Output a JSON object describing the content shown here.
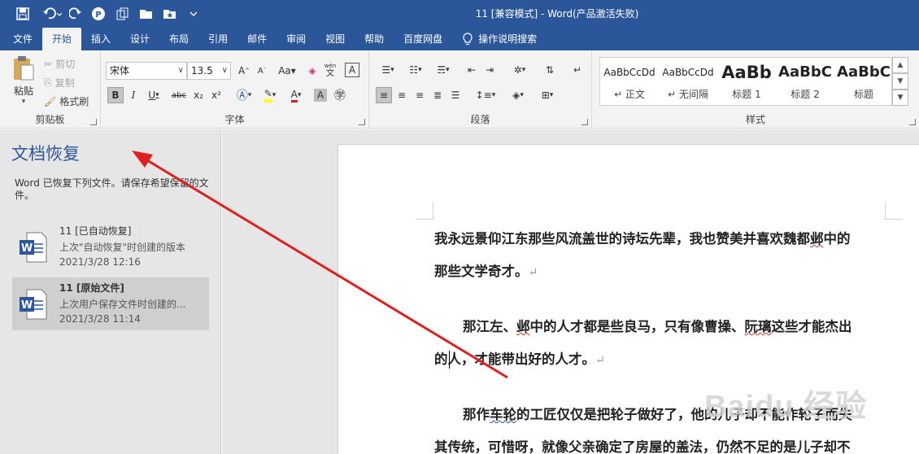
{
  "window": {
    "title": "11  [兼容模式]  -  Word(产品激活失败)"
  },
  "quick_access": [
    "save-icon",
    "undo-icon",
    "redo-icon",
    "p-icon",
    "copy-layout-icon",
    "open-folder-icon",
    "star-folder-icon",
    "customize-icon"
  ],
  "tabs": [
    "文件",
    "开始",
    "插入",
    "设计",
    "布局",
    "引用",
    "邮件",
    "审阅",
    "视图",
    "帮助",
    "百度网盘",
    "操作说明搜索"
  ],
  "active_tab": "开始",
  "ribbon": {
    "clipboard": {
      "paste": "粘贴",
      "cut": "剪切",
      "copy": "复制",
      "format_painter": "格式刷",
      "label": "剪贴板"
    },
    "font": {
      "font_name": "宋体",
      "font_size": "13.5",
      "label": "字体",
      "aa": "Aa",
      "bold": "B",
      "italic": "I",
      "underline": "U",
      "strike": "abc",
      "sub": "x₂",
      "sup": "x²",
      "a_letter": "A",
      "wen": "文",
      "a_char": "A"
    },
    "paragraph": {
      "label": "段落"
    },
    "styles": {
      "label": "样式",
      "items": [
        {
          "sample": "AaBbCcDd",
          "name": "↵ 正文"
        },
        {
          "sample": "AaBbCcDd",
          "name": "↵ 无间隔"
        },
        {
          "sample": "AaBb",
          "name": "标题 1"
        },
        {
          "sample": "AaBbC",
          "name": "标题 2"
        },
        {
          "sample": "AaBbC",
          "name": "标题"
        }
      ]
    }
  },
  "recovery": {
    "title": "文档恢复",
    "message": "Word 已恢复下列文件。请保存希望保留的文件。",
    "files": [
      {
        "name": "11  [已自动恢复]",
        "desc": "上次\"自动恢复\"时创建的版本",
        "date": "2021/3/28 12:16"
      },
      {
        "name": "11  [原始文件]",
        "desc": "上次用户保存文件时创建的...",
        "date": "2021/3/28 11:14"
      }
    ]
  },
  "document": {
    "p1_line1_a": "我永远景仰江东那些风流盖世的诗坛先辈，我也赞美并喜欢魏都",
    "p1_line1_ye": "邺",
    "p1_line1_b": "中的",
    "p1_line2": "那些文学奇才。",
    "p2_line1_a": "那江左、",
    "p2_line1_ye": "邺",
    "p2_line1_b": "中的人才都是些良马，只有像曹操、",
    "p2_line1_c": "阮璃",
    "p2_line1_d": "这些才能杰出",
    "p2_line2": "的人，才能带出好的人才。",
    "p3_line1_a": "那作",
    "p3_line1_b": "车轮",
    "p3_line1_c": "的工匠仅仅是把轮子做好了，他的儿子却不能作轮子而失",
    "p3_line2": "其传统，可惜呀，就像父亲确定了房屋的盖法，仍然不足的是儿子却不",
    "para_mark": "↵"
  },
  "watermark": "Baidu 经验",
  "colors": {
    "brand": "#2b579a",
    "arrow": "#e02020"
  }
}
